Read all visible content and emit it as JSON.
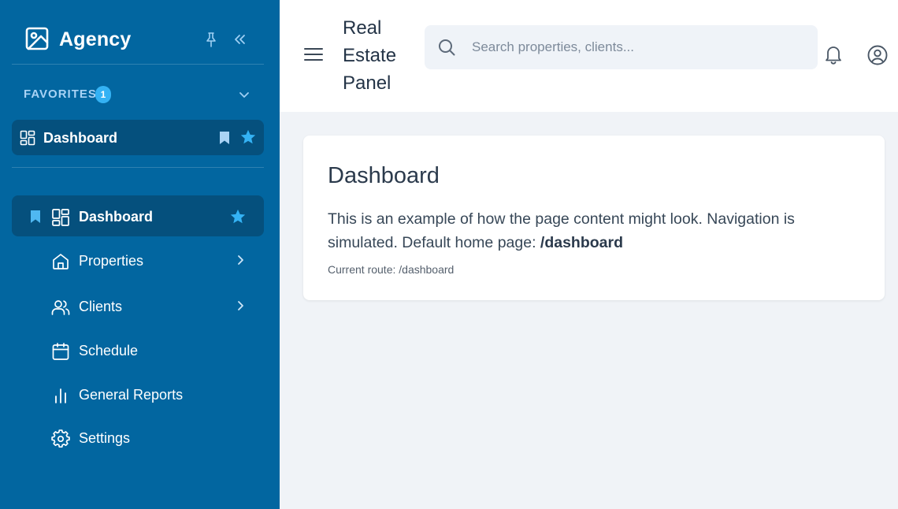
{
  "sidebar": {
    "brand": "Agency",
    "favorites": {
      "title": "FAVORITES",
      "count": "1",
      "items": [
        {
          "label": "Dashboard"
        }
      ]
    },
    "nav": [
      {
        "label": "Dashboard",
        "icon": "grid-icon",
        "active": true,
        "starred": true
      },
      {
        "label": "Properties",
        "icon": "home-icon",
        "has_children": true
      },
      {
        "label": "Clients",
        "icon": "users-icon",
        "has_children": true
      },
      {
        "label": "Schedule",
        "icon": "calendar-icon"
      },
      {
        "label": "General Reports",
        "icon": "bar-chart-icon"
      },
      {
        "label": "Settings",
        "icon": "gear-icon"
      }
    ]
  },
  "header": {
    "title_lines": [
      "Real",
      "Estate",
      "Panel"
    ],
    "search_placeholder": "Search properties, clients..."
  },
  "main": {
    "heading": "Dashboard",
    "description_prefix": "This is an example of how the page content might look. Navigation is simulated. Default home page: ",
    "home_route": "/dashboard",
    "current_route": "Current route: /dashboard"
  },
  "colors": {
    "sidebar_bg": "#0266a0",
    "active_bg": "#05507d",
    "accent": "#34b2f4",
    "content_bg": "#f0f3f7"
  }
}
